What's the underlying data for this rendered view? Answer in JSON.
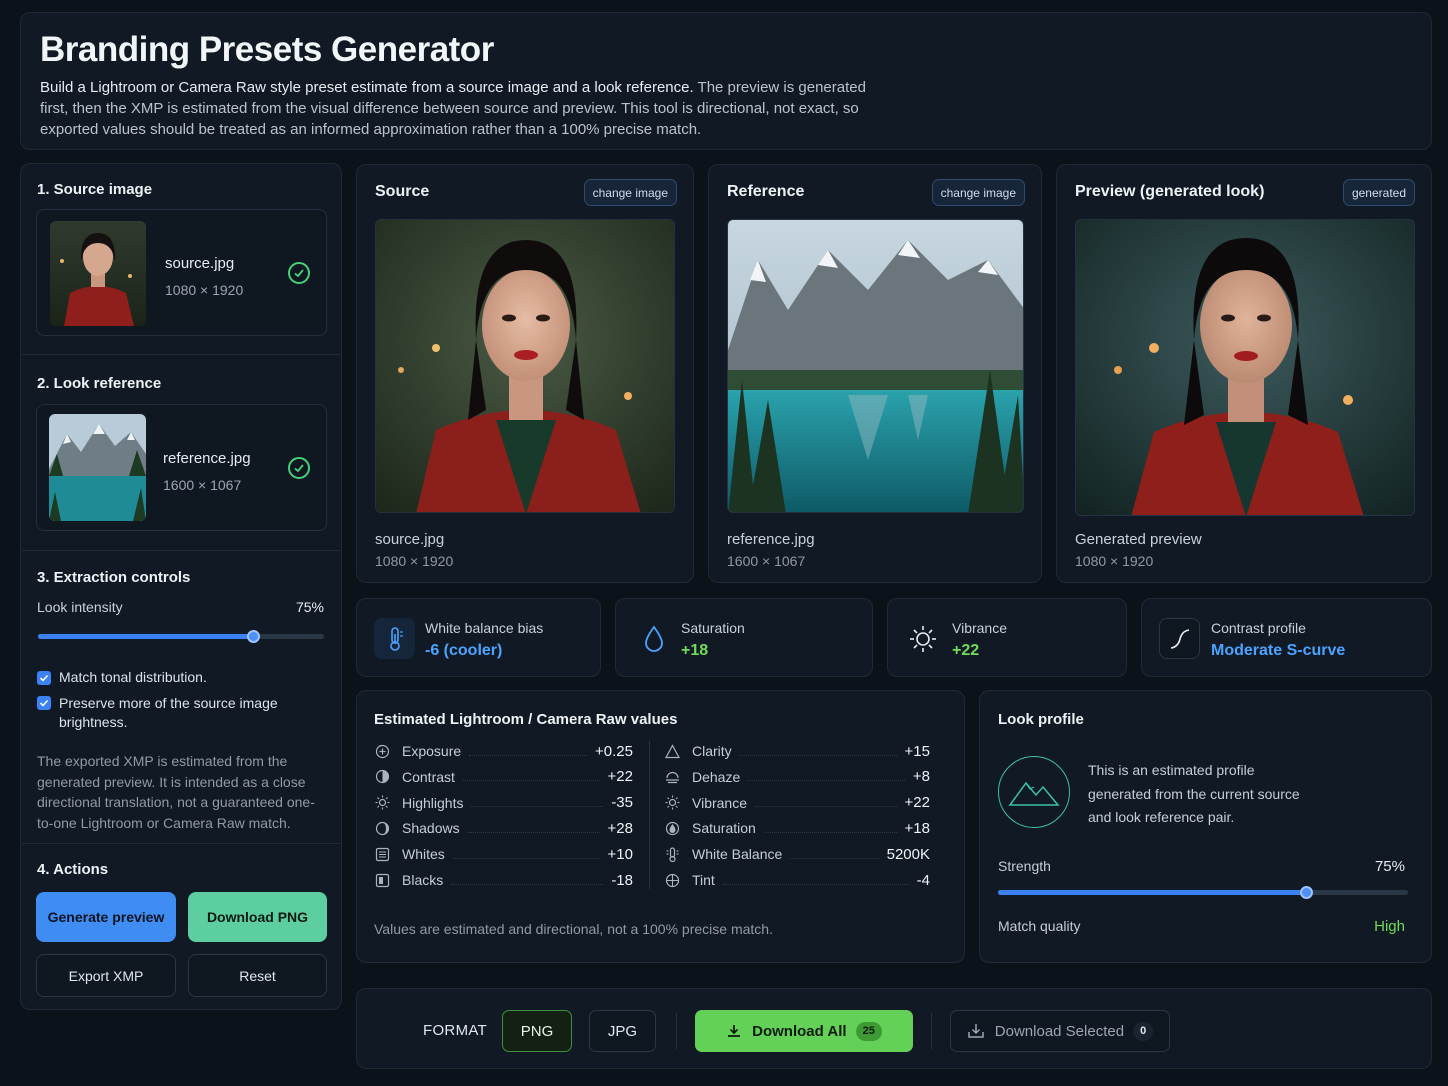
{
  "header": {
    "title": "Branding Presets Generator",
    "desc_em": "Build a Lightroom or Camera Raw style preset estimate from a source image and a look reference.",
    "desc_rest": " The preview is generated first, then the XMP is estimated from the visual difference between source and preview. This tool is directional, not exact, so exported values should be treated as an informed approximation rather than a 100% precise match."
  },
  "sidebar": {
    "source_title": "1. Source image",
    "source_file": {
      "name": "source.jpg",
      "dims": "1080 × 1920"
    },
    "look_title": "2. Look reference",
    "look_file": {
      "name": "reference.jpg",
      "dims": "1600 × 1067"
    },
    "controls_title": "3. Extraction controls",
    "intensity_label": "Look intensity",
    "intensity_value": "75%",
    "intensity_fraction": 0.75,
    "checkbox_1": "Match tonal distribution.",
    "checkbox_2": "Preserve more of the source image brightness.",
    "note": "The exported XMP is estimated from the generated preview. It is intended as a close directional translation, not a guaranteed one-to-one Lightroom or Camera Raw match.",
    "actions_title": "4. Actions",
    "generate_label": "Generate preview",
    "download_png_label": "Download PNG",
    "export_label": "Export XMP",
    "reset_label": "Reset"
  },
  "cards": {
    "source": {
      "title": "Source",
      "chip": "change image",
      "name": "source.jpg",
      "dims": "1080 × 1920"
    },
    "reference": {
      "title": "Reference",
      "chip": "change image",
      "name": "reference.jpg",
      "dims": "1600 × 1067"
    },
    "preview": {
      "title": "Preview (generated look)",
      "chip": "generated",
      "name": "Generated preview",
      "dims": "1080 × 1920"
    }
  },
  "stats": {
    "wb": {
      "label": "White balance bias",
      "value": "-6 (cooler)"
    },
    "sat": {
      "label": "Saturation",
      "value": "+18"
    },
    "vib": {
      "label": "Vibrance",
      "value": "+22"
    },
    "contrast": {
      "label": "Contrast profile",
      "value": "Moderate S-curve"
    }
  },
  "values": {
    "title": "Estimated Lightroom / Camera Raw values",
    "left": [
      {
        "label": "Exposure",
        "value": "+0.25",
        "icon": "plus-circle-icon"
      },
      {
        "label": "Contrast",
        "value": "+22",
        "icon": "contrast-icon"
      },
      {
        "label": "Highlights",
        "value": "-35",
        "icon": "sun-icon"
      },
      {
        "label": "Shadows",
        "value": "+28",
        "icon": "shadow-icon"
      },
      {
        "label": "Whites",
        "value": "+10",
        "icon": "whites-icon"
      },
      {
        "label": "Blacks",
        "value": "-18",
        "icon": "blacks-icon"
      }
    ],
    "right": [
      {
        "label": "Clarity",
        "value": "+15",
        "icon": "triangle-icon"
      },
      {
        "label": "Dehaze",
        "value": "+8",
        "icon": "haze-icon"
      },
      {
        "label": "Vibrance",
        "value": "+22",
        "icon": "sun-icon"
      },
      {
        "label": "Saturation",
        "value": "+18",
        "icon": "saturation-icon"
      },
      {
        "label": "White Balance",
        "value": "5200K",
        "icon": "wb-icon"
      },
      {
        "label": "Tint",
        "value": "-4",
        "icon": "tint-icon"
      }
    ],
    "footnote": "Values are estimated and directional, not a 100% precise match."
  },
  "look": {
    "title": "Look profile",
    "desc": "This is an estimated profile generated from the current source and look reference pair.",
    "strength_label": "Strength",
    "strength_value": "75%",
    "strength_fraction": 0.75,
    "quality_label": "Match quality",
    "quality_value": "High"
  },
  "bottom": {
    "format_label": "FORMAT",
    "png": "PNG",
    "jpg": "JPG",
    "download_all": "Download All",
    "download_all_count": "25",
    "download_selected": "Download Selected",
    "download_selected_count": "0"
  },
  "colors": {
    "accent": "#3b82f6",
    "green": "#43d17a",
    "stat_blue": "#4aa3ff",
    "stat_green": "#6fdc5b"
  }
}
